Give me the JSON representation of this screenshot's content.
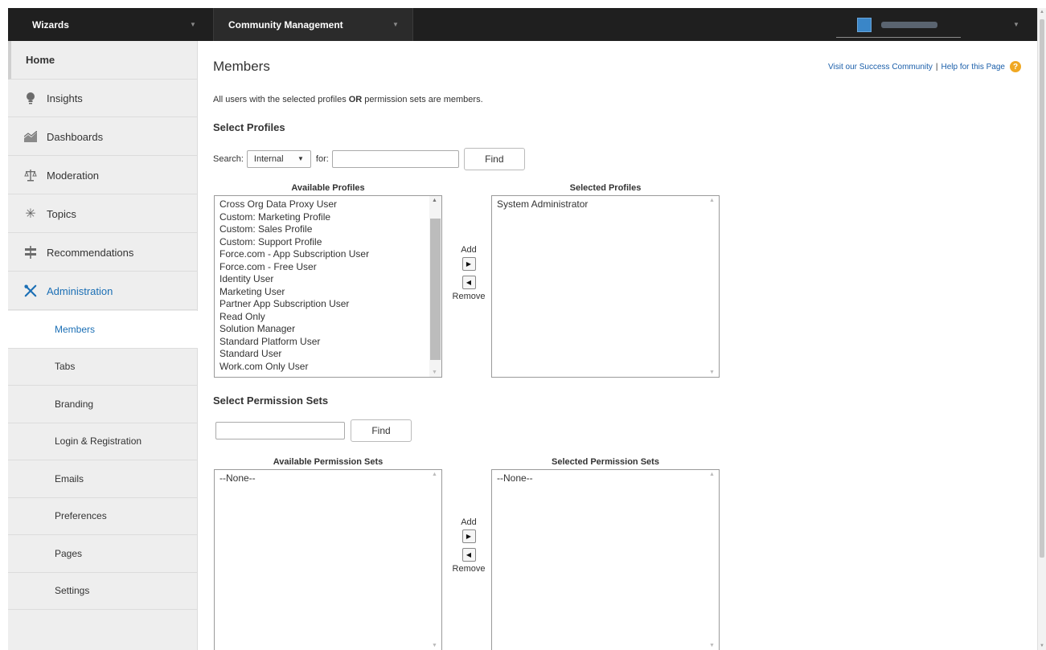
{
  "topbar": {
    "wizards_label": "Wizards",
    "community_label": "Community Management"
  },
  "sidebar": {
    "home_label": "Home",
    "items": [
      {
        "label": "Insights",
        "icon": "lightbulb-icon"
      },
      {
        "label": "Dashboards",
        "icon": "chart-icon"
      },
      {
        "label": "Moderation",
        "icon": "scales-icon"
      },
      {
        "label": "Topics",
        "icon": "asterisk-icon"
      },
      {
        "label": "Recommendations",
        "icon": "signpost-icon"
      },
      {
        "label": "Administration",
        "icon": "wrench-icon"
      }
    ],
    "sub_items": [
      {
        "label": "Members",
        "active": true
      },
      {
        "label": "Tabs"
      },
      {
        "label": "Branding"
      },
      {
        "label": "Login & Registration"
      },
      {
        "label": "Emails"
      },
      {
        "label": "Preferences"
      },
      {
        "label": "Pages"
      },
      {
        "label": "Settings"
      }
    ]
  },
  "main": {
    "title": "Members",
    "help": {
      "success_link": "Visit our Success Community",
      "separator": "|",
      "help_link": "Help for this Page",
      "help_icon": "?"
    },
    "intro_before": "All users with the selected profiles ",
    "intro_bold": "OR",
    "intro_after": " permission sets are members.",
    "profiles": {
      "heading": "Select Profiles",
      "search_label": "Search:",
      "search_select_value": "Internal",
      "for_label": "for:",
      "search_value": "",
      "find_label": "Find",
      "available_label": "Available Profiles",
      "selected_label": "Selected Profiles",
      "available": [
        "Cross Org Data Proxy User",
        "Custom: Marketing Profile",
        "Custom: Sales Profile",
        "Custom: Support Profile",
        "Force.com - App Subscription User",
        "Force.com - Free User",
        "Identity User",
        "Marketing User",
        "Partner App Subscription User",
        "Read Only",
        "Solution Manager",
        "Standard Platform User",
        "Standard User",
        "Work.com Only User"
      ],
      "selected": [
        "System Administrator"
      ],
      "add_label": "Add",
      "remove_label": "Remove"
    },
    "permission_sets": {
      "heading": "Select Permission Sets",
      "search_value": "",
      "find_label": "Find",
      "available_label": "Available Permission Sets",
      "selected_label": "Selected Permission Sets",
      "available": [
        "--None--"
      ],
      "selected": [
        "--None--"
      ],
      "add_label": "Add",
      "remove_label": "Remove"
    }
  },
  "colors": {
    "topbar": "#1f1f1f",
    "sidebar": "#eeeeee",
    "link": "#1b6fb5",
    "help_icon": "#f0a823"
  }
}
